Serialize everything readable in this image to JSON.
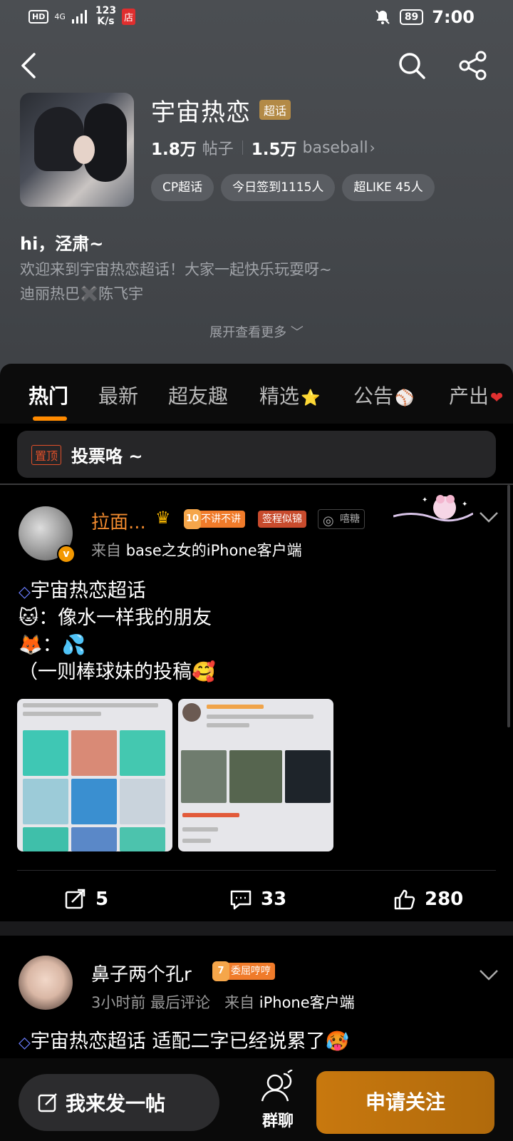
{
  "status_bar": {
    "hd": "HD",
    "signal": "4G",
    "net_speed_value": "123",
    "net_speed_unit": "K/s",
    "store_badge": "店",
    "battery": "89",
    "time": "7:00"
  },
  "community": {
    "title": "宇宙热恋",
    "badge": "超话",
    "posts_count": "1.8万",
    "posts_label": "帖子",
    "members_count": "1.5万",
    "members_label": "baseball",
    "chips": [
      "CP超话",
      "今日签到1115人",
      "超LIKE 45人"
    ],
    "greeting": "hi，泾肃~",
    "description_line1": "欢迎来到宇宙热恋超话！大家一起快乐玩耍呀~",
    "description_line2": "迪丽热巴✖️陈飞宇",
    "expand_label": "展开查看更多"
  },
  "tabs": [
    {
      "label": "热门",
      "active": true
    },
    {
      "label": "最新"
    },
    {
      "label": "超友趣"
    },
    {
      "label": "精选",
      "emoji": "⭐"
    },
    {
      "label": "公告",
      "emoji": "⚾"
    },
    {
      "label": "产出",
      "emoji": "❤"
    }
  ],
  "pinned": {
    "badge": "置顶",
    "title": "投票咯 ~"
  },
  "post1": {
    "author": "拉面...",
    "level": "10",
    "level_badge": "不讲不讲",
    "sign_badge": "签程似锦",
    "sugar_badge": "嘻糖",
    "source_prefix": "来自",
    "source_device": "base之女的iPhone客户端",
    "line1": "宇宙热恋超话",
    "line2": "🐱：像水一样我的朋友",
    "line3": "🦊：💦",
    "line4": "（一则棒球妹的投稿🥰",
    "reposts": "5",
    "comments": "33",
    "likes": "280"
  },
  "post2": {
    "author": "鼻子两个孔r",
    "level": "7",
    "level_badge": "委屈哼哼",
    "time": "3小时前",
    "last_comment": "最后评论",
    "source_prefix": "来自",
    "source_device": "iPhone客户端",
    "text": "宇宙热恋超话  适配二字已经说累了🥵"
  },
  "bottom": {
    "post_label": "我来发一帖",
    "group_label": "群聊",
    "follow_label": "申请关注"
  },
  "colors": {
    "accent": "#ff8a00",
    "follow_button": "#b06a0c",
    "author_name": "#f08a2e",
    "header_bg": "#47494d"
  }
}
